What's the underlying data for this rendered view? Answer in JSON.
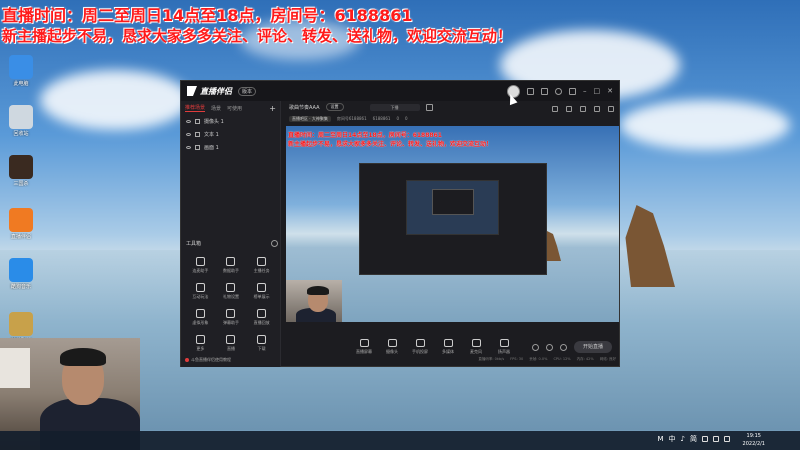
{
  "banner": {
    "line1": "直播时间：周二至周日14点至18点，房间号：6188861",
    "line2": "新主播起步不易，恳求大家多多关注、评论、转发、送礼物，欢迎交流互动！"
  },
  "desktop_icons": [
    {
      "label": "此电脑",
      "icon": "computer-icon",
      "color": "#3a8ee6"
    },
    {
      "label": "回收站",
      "icon": "recycle-bin-icon",
      "color": "#cfd8e0"
    },
    {
      "label": "三国杀",
      "icon": "game-icon",
      "color": "#3a2a20"
    },
    {
      "label": "直播伴侣",
      "icon": "app-icon",
      "color": "#f07a22"
    },
    {
      "label": "酷狗音乐",
      "icon": "kugou-icon",
      "color": "#2a8ce8"
    },
    {
      "label": "英雄联盟",
      "icon": "lol-icon",
      "color": "#c8a14a"
    }
  ],
  "app": {
    "title": "直播伴侣",
    "version": "版本",
    "left_tabs": [
      "推荐场景",
      "场景",
      "可使用"
    ],
    "scenes": [
      "摄像头 1",
      "文本 1",
      "画面 1"
    ],
    "tools_title": "工具箱",
    "tools": [
      {
        "label": "连麦助手",
        "icon": "link-icon"
      },
      {
        "label": "数据助手",
        "icon": "user-icon"
      },
      {
        "label": "主播任务",
        "icon": "task-icon"
      },
      {
        "label": "互动玩法",
        "icon": "game-icon"
      },
      {
        "label": "礼物设置",
        "icon": "download-icon"
      },
      {
        "label": "榜单展示",
        "icon": "list-icon"
      },
      {
        "label": "虚拟形象",
        "icon": "avatar-icon"
      },
      {
        "label": "弹幕助手",
        "icon": "danmu-icon"
      },
      {
        "label": "直播回放",
        "icon": "replay-icon"
      },
      {
        "label": "更多",
        "icon": "grid-icon"
      },
      {
        "label": "直播",
        "icon": "live-icon"
      },
      {
        "label": "下载",
        "icon": "download-icon"
      }
    ],
    "footer_note": "斗鱼直播伴侣使用教程",
    "room_title": "歌曲节奏AAA",
    "room_pill": "设置",
    "room_box": "下播",
    "meta_tag": "直播吧区 · 大神聚集",
    "meta_id": "房间号6188861",
    "meta_count": "6188861",
    "meta_a": "0",
    "meta_b": "0",
    "preview_banner1": "直播时间：周二至周日14点至18点，房间号：6188861",
    "preview_banner2": "新主播起步不易，恳求大家多多关注、评论、转发、送礼物，欢迎交流互动！",
    "bottom_tools": [
      {
        "label": "直播屏幕",
        "icon": "screen-icon"
      },
      {
        "label": "摄像头",
        "icon": "camera-icon"
      },
      {
        "label": "手机投屏",
        "icon": "phone-icon"
      },
      {
        "label": "多媒体",
        "icon": "media-icon"
      },
      {
        "label": "麦克风",
        "icon": "mic-icon"
      },
      {
        "label": "扬声器",
        "icon": "speaker-icon"
      }
    ],
    "go_live": "开始直播",
    "status": [
      "直播码率: 0kb/s",
      "FPS: 30",
      "丢帧: 0.0%",
      "CPU: 12%",
      "内存: 42%",
      "网络: 良好"
    ]
  },
  "taskbar": {
    "tray_items": [
      "M",
      "中",
      "♪",
      "简"
    ],
    "time": "19:15",
    "date": "2022/2/1"
  }
}
